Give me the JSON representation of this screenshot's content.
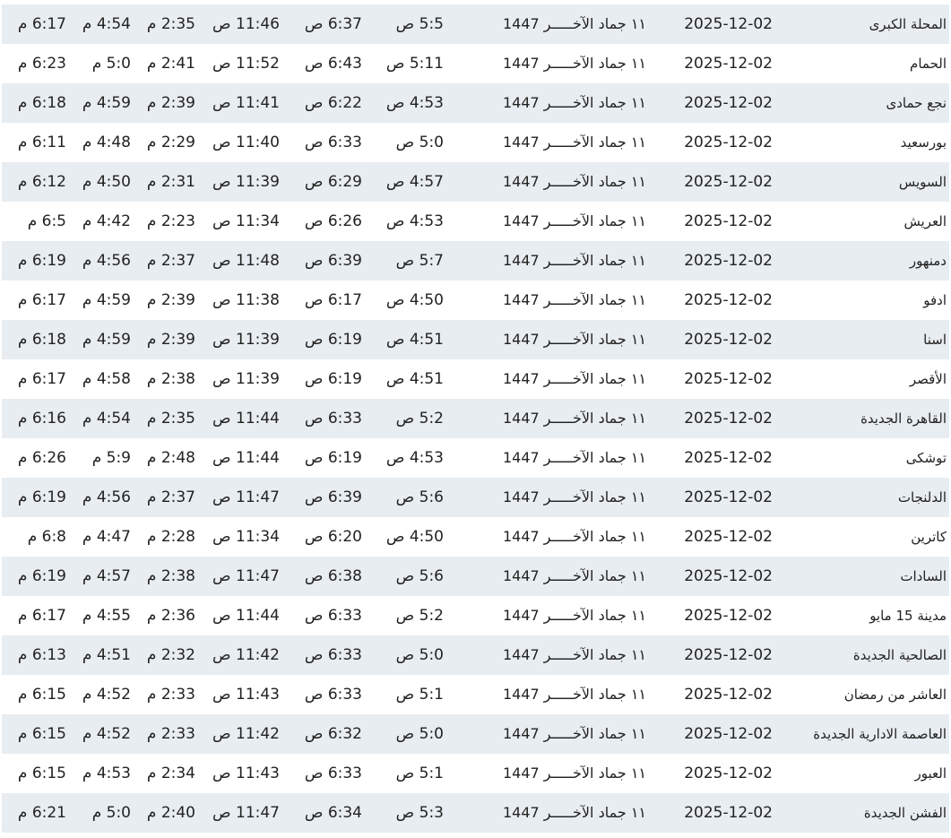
{
  "rows": [
    {
      "city": "المحلة الكبرى",
      "date": "2025-12-02",
      "hijri": "١١ جماد الآخـــــر 1447",
      "fajr": "5:5 ص",
      "sunrise": "6:37 ص",
      "dhuhr": "11:46 ص",
      "asr": "2:35 م",
      "maghrib": "4:54 م",
      "isha": "6:17 م"
    },
    {
      "city": "الحمام",
      "date": "2025-12-02",
      "hijri": "١١ جماد الآخـــــر 1447",
      "fajr": "5:11 ص",
      "sunrise": "6:43 ص",
      "dhuhr": "11:52 ص",
      "asr": "2:41 م",
      "maghrib": "5:0 م",
      "isha": "6:23 م"
    },
    {
      "city": "نجع حمادى",
      "date": "2025-12-02",
      "hijri": "١١ جماد الآخـــــر 1447",
      "fajr": "4:53 ص",
      "sunrise": "6:22 ص",
      "dhuhr": "11:41 ص",
      "asr": "2:39 م",
      "maghrib": "4:59 م",
      "isha": "6:18 م"
    },
    {
      "city": "بورسعيد",
      "date": "2025-12-02",
      "hijri": "١١ جماد الآخـــــر 1447",
      "fajr": "5:0 ص",
      "sunrise": "6:33 ص",
      "dhuhr": "11:40 ص",
      "asr": "2:29 م",
      "maghrib": "4:48 م",
      "isha": "6:11 م"
    },
    {
      "city": "السويس",
      "date": "2025-12-02",
      "hijri": "١١ جماد الآخـــــر 1447",
      "fajr": "4:57 ص",
      "sunrise": "6:29 ص",
      "dhuhr": "11:39 ص",
      "asr": "2:31 م",
      "maghrib": "4:50 م",
      "isha": "6:12 م"
    },
    {
      "city": "العريش",
      "date": "2025-12-02",
      "hijri": "١١ جماد الآخـــــر 1447",
      "fajr": "4:53 ص",
      "sunrise": "6:26 ص",
      "dhuhr": "11:34 ص",
      "asr": "2:23 م",
      "maghrib": "4:42 م",
      "isha": "6:5 م"
    },
    {
      "city": "دمنهور",
      "date": "2025-12-02",
      "hijri": "١١ جماد الآخـــــر 1447",
      "fajr": "5:7 ص",
      "sunrise": "6:39 ص",
      "dhuhr": "11:48 ص",
      "asr": "2:37 م",
      "maghrib": "4:56 م",
      "isha": "6:19 م"
    },
    {
      "city": "ادفو",
      "date": "2025-12-02",
      "hijri": "١١ جماد الآخـــــر 1447",
      "fajr": "4:50 ص",
      "sunrise": "6:17 ص",
      "dhuhr": "11:38 ص",
      "asr": "2:39 م",
      "maghrib": "4:59 م",
      "isha": "6:17 م"
    },
    {
      "city": "اسنا",
      "date": "2025-12-02",
      "hijri": "١١ جماد الآخـــــر 1447",
      "fajr": "4:51 ص",
      "sunrise": "6:19 ص",
      "dhuhr": "11:39 ص",
      "asr": "2:39 م",
      "maghrib": "4:59 م",
      "isha": "6:18 م"
    },
    {
      "city": "الأقصر",
      "date": "2025-12-02",
      "hijri": "١١ جماد الآخـــــر 1447",
      "fajr": "4:51 ص",
      "sunrise": "6:19 ص",
      "dhuhr": "11:39 ص",
      "asr": "2:38 م",
      "maghrib": "4:58 م",
      "isha": "6:17 م"
    },
    {
      "city": "القاهرة الجديدة",
      "date": "2025-12-02",
      "hijri": "١١ جماد الآخـــــر 1447",
      "fajr": "5:2 ص",
      "sunrise": "6:33 ص",
      "dhuhr": "11:44 ص",
      "asr": "2:35 م",
      "maghrib": "4:54 م",
      "isha": "6:16 م"
    },
    {
      "city": "توشكى",
      "date": "2025-12-02",
      "hijri": "١١ جماد الآخـــــر 1447",
      "fajr": "4:53 ص",
      "sunrise": "6:19 ص",
      "dhuhr": "11:44 ص",
      "asr": "2:48 م",
      "maghrib": "5:9 م",
      "isha": "6:26 م"
    },
    {
      "city": "الدلنجات",
      "date": "2025-12-02",
      "hijri": "١١ جماد الآخـــــر 1447",
      "fajr": "5:6 ص",
      "sunrise": "6:39 ص",
      "dhuhr": "11:47 ص",
      "asr": "2:37 م",
      "maghrib": "4:56 م",
      "isha": "6:19 م"
    },
    {
      "city": "كاترين",
      "date": "2025-12-02",
      "hijri": "١١ جماد الآخـــــر 1447",
      "fajr": "4:50 ص",
      "sunrise": "6:20 ص",
      "dhuhr": "11:34 ص",
      "asr": "2:28 م",
      "maghrib": "4:47 م",
      "isha": "6:8 م"
    },
    {
      "city": "السادات",
      "date": "2025-12-02",
      "hijri": "١١ جماد الآخـــــر 1447",
      "fajr": "5:6 ص",
      "sunrise": "6:38 ص",
      "dhuhr": "11:47 ص",
      "asr": "2:38 م",
      "maghrib": "4:57 م",
      "isha": "6:19 م"
    },
    {
      "city": "مدينة 15 مايو",
      "date": "2025-12-02",
      "hijri": "١١ جماد الآخـــــر 1447",
      "fajr": "5:2 ص",
      "sunrise": "6:33 ص",
      "dhuhr": "11:44 ص",
      "asr": "2:36 م",
      "maghrib": "4:55 م",
      "isha": "6:17 م"
    },
    {
      "city": "الصالحية الجديدة",
      "date": "2025-12-02",
      "hijri": "١١ جماد الآخـــــر 1447",
      "fajr": "5:0 ص",
      "sunrise": "6:33 ص",
      "dhuhr": "11:42 ص",
      "asr": "2:32 م",
      "maghrib": "4:51 م",
      "isha": "6:13 م"
    },
    {
      "city": "العاشر من رمضان",
      "date": "2025-12-02",
      "hijri": "١١ جماد الآخـــــر 1447",
      "fajr": "5:1 ص",
      "sunrise": "6:33 ص",
      "dhuhr": "11:43 ص",
      "asr": "2:33 م",
      "maghrib": "4:52 م",
      "isha": "6:15 م"
    },
    {
      "city": "العاصمة الادارية الجديدة",
      "date": "2025-12-02",
      "hijri": "١١ جماد الآخـــــر 1447",
      "fajr": "5:0 ص",
      "sunrise": "6:32 ص",
      "dhuhr": "11:42 ص",
      "asr": "2:33 م",
      "maghrib": "4:52 م",
      "isha": "6:15 م"
    },
    {
      "city": "العبور",
      "date": "2025-12-02",
      "hijri": "١١ جماد الآخـــــر 1447",
      "fajr": "5:1 ص",
      "sunrise": "6:33 ص",
      "dhuhr": "11:43 ص",
      "asr": "2:34 م",
      "maghrib": "4:53 م",
      "isha": "6:15 م"
    },
    {
      "city": "الفشن الجديدة",
      "date": "2025-12-02",
      "hijri": "١١ جماد الآخـــــر 1447",
      "fajr": "5:3 ص",
      "sunrise": "6:34 ص",
      "dhuhr": "11:47 ص",
      "asr": "2:40 م",
      "maghrib": "5:0 م",
      "isha": "6:21 م"
    }
  ]
}
